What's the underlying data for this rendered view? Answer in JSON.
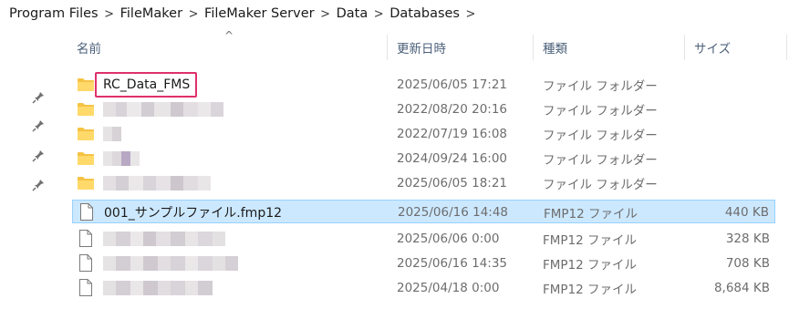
{
  "breadcrumb": [
    "Program Files",
    "FileMaker",
    "FileMaker Server",
    "Data",
    "Databases"
  ],
  "columns": {
    "name": "名前",
    "date": "更新日時",
    "type": "種類",
    "size": "サイズ"
  },
  "rows": [
    {
      "kind": "folder",
      "name": "RC_Data_FMS",
      "date": "2025/06/05 17:21",
      "type": "ファイル フォルダー",
      "size": ""
    },
    {
      "kind": "folder",
      "name": "",
      "date": "2022/08/20 20:16",
      "type": "ファイル フォルダー",
      "size": ""
    },
    {
      "kind": "folder",
      "name": "",
      "date": "2022/07/19 16:08",
      "type": "ファイル フォルダー",
      "size": ""
    },
    {
      "kind": "folder",
      "name": "",
      "date": "2024/09/24 16:00",
      "type": "ファイル フォルダー",
      "size": ""
    },
    {
      "kind": "folder",
      "name": "",
      "date": "2025/06/05 18:21",
      "type": "ファイル フォルダー",
      "size": ""
    },
    {
      "kind": "file",
      "name": "001_サンプルファイル.fmp12",
      "date": "2025/06/16 14:48",
      "type": "FMP12 ファイル",
      "size": "440 KB"
    },
    {
      "kind": "file",
      "name": "",
      "date": "2025/06/06 0:00",
      "type": "FMP12 ファイル",
      "size": "328 KB"
    },
    {
      "kind": "file",
      "name": "",
      "date": "2025/06/16 14:35",
      "type": "FMP12 ファイル",
      "size": "708 KB"
    },
    {
      "kind": "file",
      "name": "",
      "date": "2025/04/18 0:00",
      "type": "FMP12 ファイル",
      "size": "8,684 KB"
    }
  ],
  "icons": {
    "folder": "folder-icon",
    "file": "file-icon",
    "pin": "pin-icon",
    "sort": "sort-ascending-icon",
    "separator": "chevron-right-icon"
  },
  "colors": {
    "selection_bg": "#cce8ff",
    "selection_border": "#99d1ff",
    "highlight_border": "#e0306a",
    "folder": "#f5c344"
  }
}
